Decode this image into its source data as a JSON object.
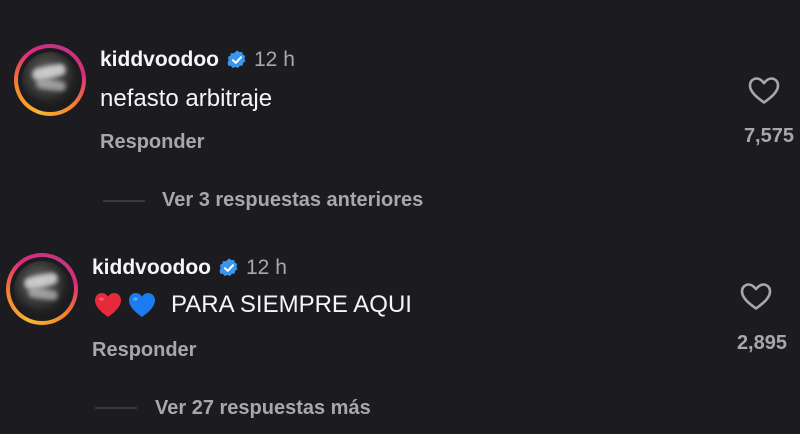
{
  "comments": [
    {
      "username": "kiddvoodoo",
      "time": "12 h",
      "text": "nefasto arbitraje",
      "emojis": [],
      "reply_label": "Responder",
      "likes": "7,575",
      "view_replies": "Ver 3 respuestas anteriores"
    },
    {
      "username": "kiddvoodoo",
      "time": "12 h",
      "text": "PARA SIEMPRE AQUI",
      "emojis": [
        "red-heart",
        "blue-heart"
      ],
      "reply_label": "Responder",
      "likes": "2,895",
      "view_replies": "Ver 27 respuestas más"
    }
  ],
  "colors": {
    "background": "#1c1c20",
    "verified": "#3797f0",
    "muted": "#a8a8a8",
    "red_heart": "#e8283b",
    "blue_heart": "#1d7bf0"
  }
}
